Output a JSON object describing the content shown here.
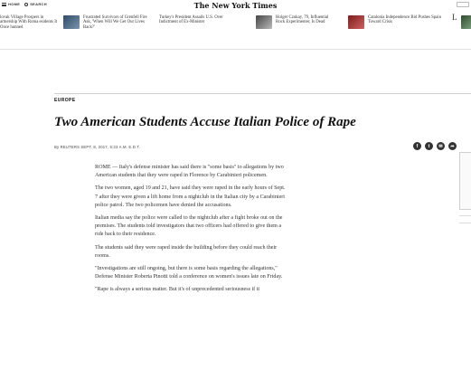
{
  "nav": {
    "menu_label": "HOME",
    "search_label": "SEARCH",
    "masthead": "The New York Times"
  },
  "strip": [
    {
      "text": "lovak Village Prospers in artnership With Roma esidents It Once hunned",
      "thumb": ""
    },
    {
      "text": "Frustrated Survivors of Grenfell Fire Ask, 'When Will We Get Our Lives Back?'",
      "thumb": "#4a6b8a"
    },
    {
      "text": "Turkey's President Assails U.S. Over Indictment of Ex-Minister",
      "thumb": ""
    },
    {
      "text": "Holger Czukay, 79, Influential Rock Experimenter, Is Dead",
      "thumb": "#8a8a8a"
    },
    {
      "text": "Catalonia Independence Bid Pushes Spain Toward Crisis",
      "thumb": "#a03a3a"
    },
    {
      "text": "L",
      "thumb": "#3a5a3a"
    }
  ],
  "article": {
    "section": "EUROPE",
    "headline": "Two American Students Accuse Italian Police of Rape",
    "byline": "By REUTERS   SEPT. 8, 2017, 5:33 A.M. E.D.T.",
    "paragraphs": [
      "ROME — Italy's defense minister has said there is \"some basis\" to allegations by two American students that they were raped in Florence by Carabinieri policemen.",
      "The two women, aged 19 and 21, have said they were raped in the early hours of Sept. 7 after they were given a lift home from a nightclub in the Italian city by a Carabinieri police patrol. The two policemen have denied the accusations.",
      "Italian media say the police were called to the nightclub after a fight broke out on the premises. The students told investigators that two officers had offered to give them a ride back to their residence.",
      "The students said they were raped inside the building before they could reach their rooms.",
      "\"Investigations are still ongoing, but there is some basis regarding the allegations,\" Defense Minister Roberta Pinotti told a conference on women's issues late on Friday.",
      "\"Rape is always a serious matter. But it's of unprecedented seriousness if it"
    ]
  },
  "share": [
    "f",
    "t",
    "✉",
    "➦"
  ]
}
